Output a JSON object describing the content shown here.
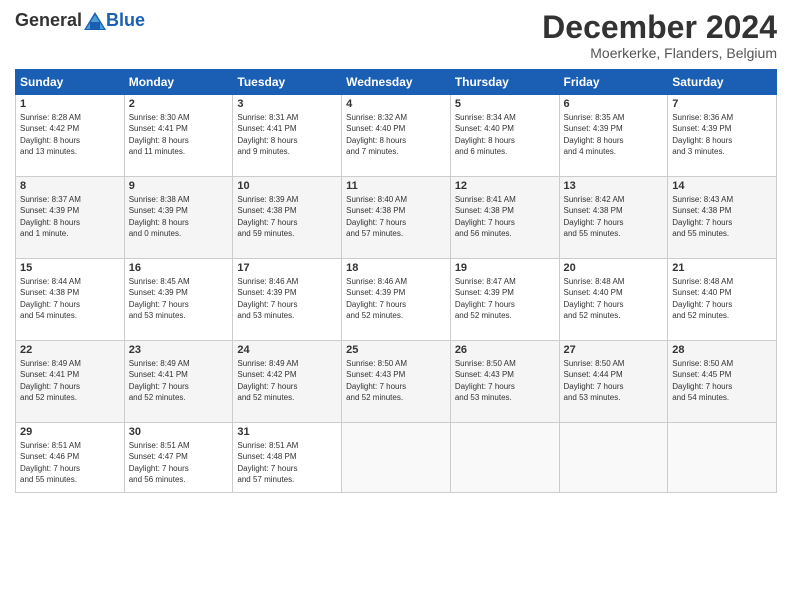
{
  "header": {
    "logo_general": "General",
    "logo_blue": "Blue",
    "month_title": "December 2024",
    "location": "Moerkerke, Flanders, Belgium"
  },
  "weekdays": [
    "Sunday",
    "Monday",
    "Tuesday",
    "Wednesday",
    "Thursday",
    "Friday",
    "Saturday"
  ],
  "weeks": [
    [
      {
        "day": "1",
        "info": "Sunrise: 8:28 AM\nSunset: 4:42 PM\nDaylight: 8 hours\nand 13 minutes."
      },
      {
        "day": "2",
        "info": "Sunrise: 8:30 AM\nSunset: 4:41 PM\nDaylight: 8 hours\nand 11 minutes."
      },
      {
        "day": "3",
        "info": "Sunrise: 8:31 AM\nSunset: 4:41 PM\nDaylight: 8 hours\nand 9 minutes."
      },
      {
        "day": "4",
        "info": "Sunrise: 8:32 AM\nSunset: 4:40 PM\nDaylight: 8 hours\nand 7 minutes."
      },
      {
        "day": "5",
        "info": "Sunrise: 8:34 AM\nSunset: 4:40 PM\nDaylight: 8 hours\nand 6 minutes."
      },
      {
        "day": "6",
        "info": "Sunrise: 8:35 AM\nSunset: 4:39 PM\nDaylight: 8 hours\nand 4 minutes."
      },
      {
        "day": "7",
        "info": "Sunrise: 8:36 AM\nSunset: 4:39 PM\nDaylight: 8 hours\nand 3 minutes."
      }
    ],
    [
      {
        "day": "8",
        "info": "Sunrise: 8:37 AM\nSunset: 4:39 PM\nDaylight: 8 hours\nand 1 minute."
      },
      {
        "day": "9",
        "info": "Sunrise: 8:38 AM\nSunset: 4:39 PM\nDaylight: 8 hours\nand 0 minutes."
      },
      {
        "day": "10",
        "info": "Sunrise: 8:39 AM\nSunset: 4:38 PM\nDaylight: 7 hours\nand 59 minutes."
      },
      {
        "day": "11",
        "info": "Sunrise: 8:40 AM\nSunset: 4:38 PM\nDaylight: 7 hours\nand 57 minutes."
      },
      {
        "day": "12",
        "info": "Sunrise: 8:41 AM\nSunset: 4:38 PM\nDaylight: 7 hours\nand 56 minutes."
      },
      {
        "day": "13",
        "info": "Sunrise: 8:42 AM\nSunset: 4:38 PM\nDaylight: 7 hours\nand 55 minutes."
      },
      {
        "day": "14",
        "info": "Sunrise: 8:43 AM\nSunset: 4:38 PM\nDaylight: 7 hours\nand 55 minutes."
      }
    ],
    [
      {
        "day": "15",
        "info": "Sunrise: 8:44 AM\nSunset: 4:38 PM\nDaylight: 7 hours\nand 54 minutes."
      },
      {
        "day": "16",
        "info": "Sunrise: 8:45 AM\nSunset: 4:39 PM\nDaylight: 7 hours\nand 53 minutes."
      },
      {
        "day": "17",
        "info": "Sunrise: 8:46 AM\nSunset: 4:39 PM\nDaylight: 7 hours\nand 53 minutes."
      },
      {
        "day": "18",
        "info": "Sunrise: 8:46 AM\nSunset: 4:39 PM\nDaylight: 7 hours\nand 52 minutes."
      },
      {
        "day": "19",
        "info": "Sunrise: 8:47 AM\nSunset: 4:39 PM\nDaylight: 7 hours\nand 52 minutes."
      },
      {
        "day": "20",
        "info": "Sunrise: 8:48 AM\nSunset: 4:40 PM\nDaylight: 7 hours\nand 52 minutes."
      },
      {
        "day": "21",
        "info": "Sunrise: 8:48 AM\nSunset: 4:40 PM\nDaylight: 7 hours\nand 52 minutes."
      }
    ],
    [
      {
        "day": "22",
        "info": "Sunrise: 8:49 AM\nSunset: 4:41 PM\nDaylight: 7 hours\nand 52 minutes."
      },
      {
        "day": "23",
        "info": "Sunrise: 8:49 AM\nSunset: 4:41 PM\nDaylight: 7 hours\nand 52 minutes."
      },
      {
        "day": "24",
        "info": "Sunrise: 8:49 AM\nSunset: 4:42 PM\nDaylight: 7 hours\nand 52 minutes."
      },
      {
        "day": "25",
        "info": "Sunrise: 8:50 AM\nSunset: 4:43 PM\nDaylight: 7 hours\nand 52 minutes."
      },
      {
        "day": "26",
        "info": "Sunrise: 8:50 AM\nSunset: 4:43 PM\nDaylight: 7 hours\nand 53 minutes."
      },
      {
        "day": "27",
        "info": "Sunrise: 8:50 AM\nSunset: 4:44 PM\nDaylight: 7 hours\nand 53 minutes."
      },
      {
        "day": "28",
        "info": "Sunrise: 8:50 AM\nSunset: 4:45 PM\nDaylight: 7 hours\nand 54 minutes."
      }
    ],
    [
      {
        "day": "29",
        "info": "Sunrise: 8:51 AM\nSunset: 4:46 PM\nDaylight: 7 hours\nand 55 minutes."
      },
      {
        "day": "30",
        "info": "Sunrise: 8:51 AM\nSunset: 4:47 PM\nDaylight: 7 hours\nand 56 minutes."
      },
      {
        "day": "31",
        "info": "Sunrise: 8:51 AM\nSunset: 4:48 PM\nDaylight: 7 hours\nand 57 minutes."
      },
      {
        "day": "",
        "info": ""
      },
      {
        "day": "",
        "info": ""
      },
      {
        "day": "",
        "info": ""
      },
      {
        "day": "",
        "info": ""
      }
    ]
  ]
}
